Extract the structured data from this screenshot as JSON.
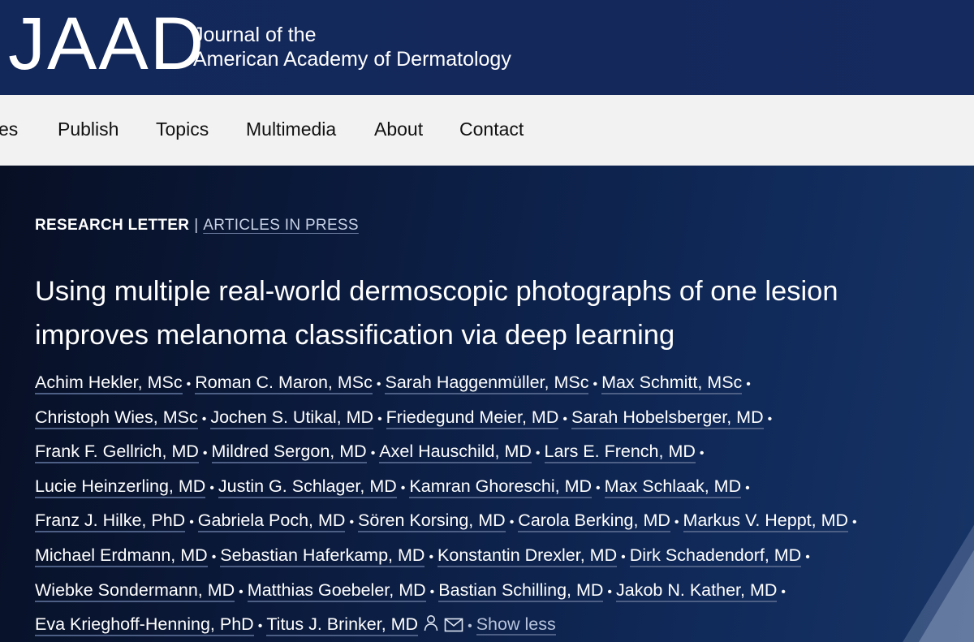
{
  "header": {
    "logo": "JAAD",
    "journal_line1": "Journal of the",
    "journal_line2": "American Academy of Dermatology"
  },
  "nav": {
    "items": [
      "es",
      "Publish",
      "Topics",
      "Multimedia",
      "About",
      "Contact"
    ]
  },
  "article": {
    "type": "RESEARCH LETTER",
    "separator": "|",
    "status": "ARTICLES IN PRESS",
    "title": "Using multiple real-world dermoscopic photographs of one lesion improves melanoma classification via deep learning",
    "authors": [
      "Achim Hekler, MSc",
      "Roman C. Maron, MSc",
      "Sarah Haggenmüller, MSc",
      "Max Schmitt, MSc",
      "Christoph Wies, MSc",
      "Jochen S. Utikal, MD",
      "Friedegund Meier, MD",
      "Sarah Hobelsberger, MD",
      "Frank F. Gellrich, MD",
      "Mildred Sergon, MD",
      "Axel Hauschild, MD",
      "Lars E. French, MD",
      "Lucie Heinzerling, MD",
      "Justin G. Schlager, MD",
      "Kamran Ghoreschi, MD",
      "Max Schlaak, MD",
      "Franz J. Hilke, PhD",
      "Gabriela Poch, MD",
      "Sören Korsing, MD",
      "Carola Berking, MD",
      "Markus V. Heppt, MD",
      "Michael Erdmann, MD",
      "Sebastian Haferkamp, MD",
      "Konstantin Drexler, MD",
      "Dirk Schadendorf, MD",
      "Wiebke Sondermann, MD",
      "Matthias Goebeler, MD",
      "Bastian Schilling, MD",
      "Jakob N. Kather, MD",
      "Eva Krieghoff-Henning, PhD",
      "Titus J. Brinker, MD"
    ],
    "show_less": "Show less",
    "icons": [
      "person-icon",
      "envelope-icon"
    ]
  }
}
